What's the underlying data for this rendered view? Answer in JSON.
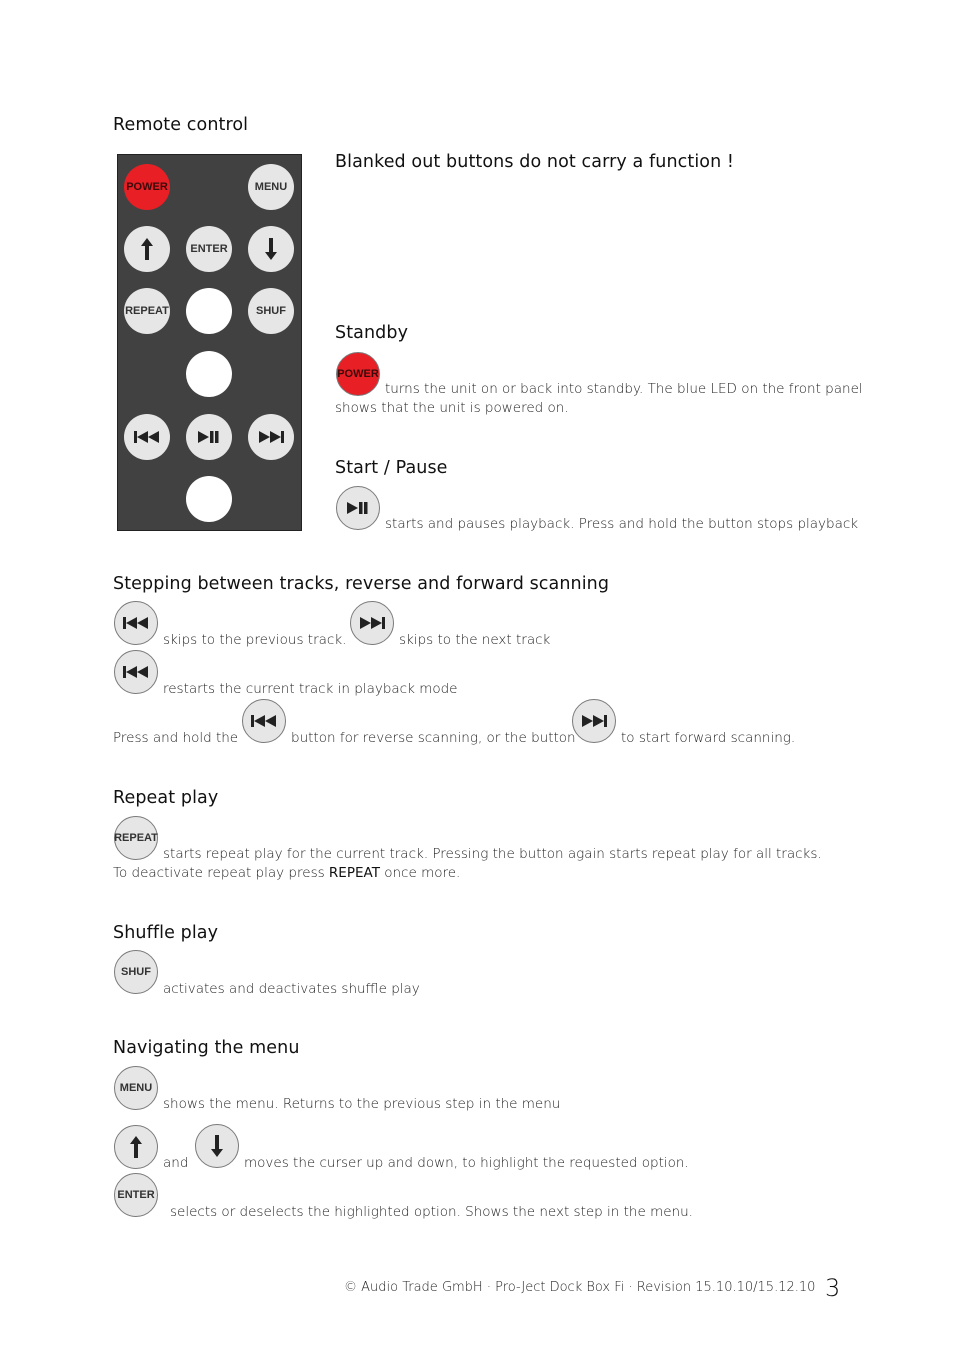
{
  "sections": {
    "remote": {
      "title": "Remote control"
    },
    "blanked_note": "Blanked out buttons do not carry a function !",
    "standby": {
      "title": "Standby",
      "line1": "turns the unit on or back into standby. The blue LED on the front panel",
      "line2": "shows that the unit is powered on."
    },
    "start_pause": {
      "title": "Start / Pause",
      "text": "starts and pauses playback. Press and hold the button stops playback"
    },
    "stepping": {
      "title": "Stepping between tracks, reverse and forward scanning",
      "prev_text": "skips to the previous track.",
      "next_text": "skips to the next track",
      "restart_text": "restarts the current track in playback mode",
      "hold_part1": "Press and hold the",
      "hold_part2": "button for reverse scanning, or the button",
      "hold_part3": "to start forward scanning."
    },
    "repeat": {
      "title": "Repeat play",
      "line1": "starts repeat play for the current track. Pressing the button again starts repeat play for all tracks.",
      "line2_pre": "To deactivate repeat play press ",
      "line2_keyword": "REPEAT",
      "line2_post": " once more."
    },
    "shuffle": {
      "title": "Shuffle play",
      "text": "activates and deactivates shuffle play"
    },
    "menu": {
      "title": "Navigating the menu",
      "menu_text": "shows the menu. Returns to the previous step in the menu",
      "and": "and",
      "updown_text": "moves the curser up and down, to highlight the requested option.",
      "enter_text": "selects or deselects the highlighted option. Shows the next step in the menu."
    }
  },
  "buttons": {
    "power": "POWER",
    "menu": "MENU",
    "enter": "ENTER",
    "repeat": "REPEAT",
    "shuf": "SHUF"
  },
  "colors": {
    "power_red": "#e81f25",
    "remote_body": "#414141",
    "button_grey": "#e6e6e6"
  },
  "footer": {
    "text": "© Audio Trade GmbH · Pro-Ject Dock Box Fi · Revision 15.10.10/15.12.10",
    "page_number": "3"
  }
}
